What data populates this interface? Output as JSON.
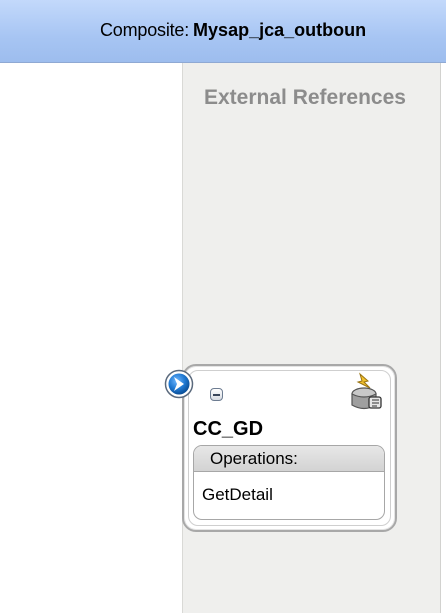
{
  "header": {
    "label": "Composite:",
    "composite_name": "Mysap_jca_outboun"
  },
  "external_references": {
    "title": "External References",
    "reference": {
      "name": "CC_GD",
      "operations_label": "Operations:",
      "operations": [
        "GetDetail"
      ],
      "icons": {
        "port": "service-port-icon",
        "collapse": "collapse-icon",
        "adapter": "adapter-icon"
      }
    }
  },
  "colors": {
    "header_bg": "#a7c5f3",
    "panel_bg": "#efefed",
    "title_text": "#8c8c8c",
    "port_blue": "#1f78d1"
  }
}
